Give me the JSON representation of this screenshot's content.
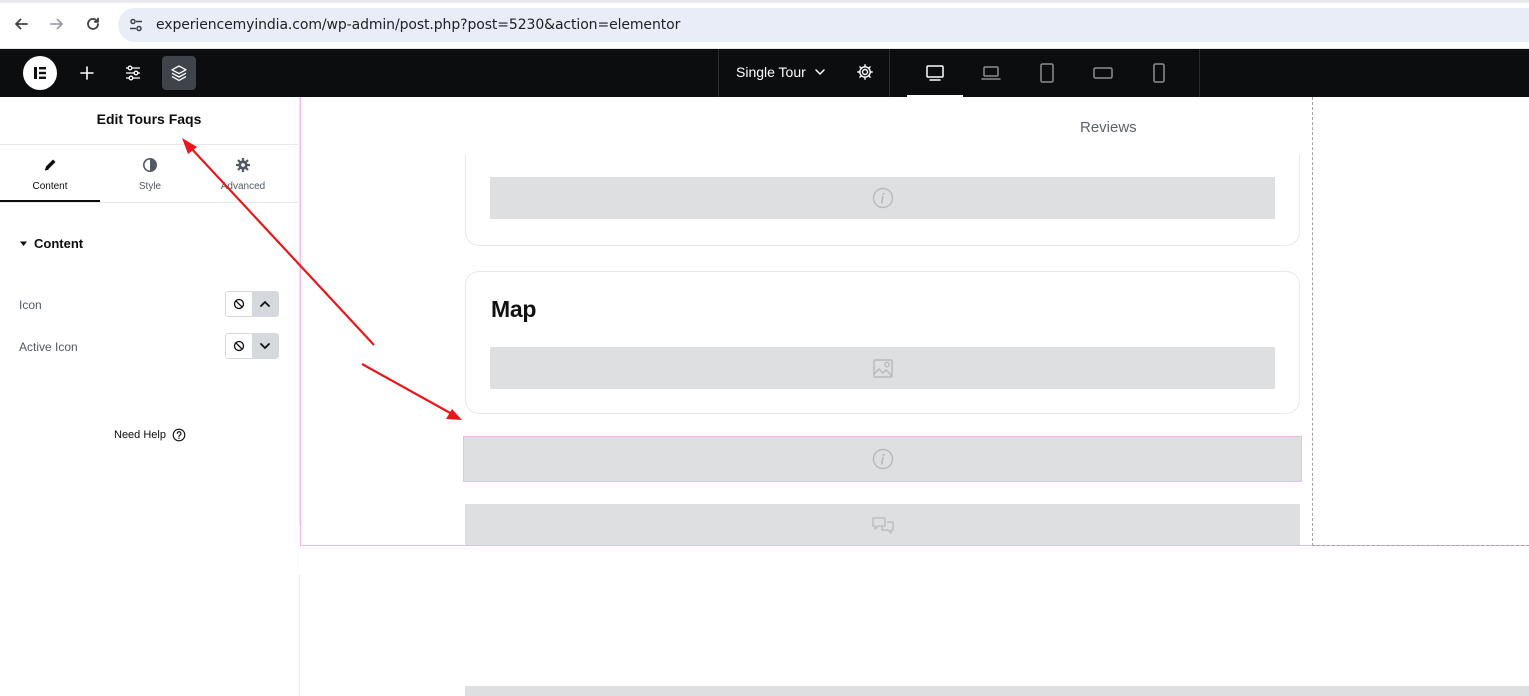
{
  "browser": {
    "url": "experiencemyindia.com/wp-admin/post.php?post=5230&action=elementor",
    "back_icon": "arrow-left-icon",
    "forward_icon": "arrow-right-icon",
    "reload_icon": "reload-icon",
    "site_info_icon": "tune-icon"
  },
  "topbar": {
    "template_name": "Single Tour",
    "devices": [
      "desktop",
      "laptop",
      "tablet",
      "tablet-landscape",
      "mobile"
    ],
    "active_device": "desktop"
  },
  "panel": {
    "title": "Edit Tours Faqs",
    "tabs": [
      {
        "label": "Content",
        "icon": "pencil-icon",
        "active": true
      },
      {
        "label": "Style",
        "icon": "half-circle-icon",
        "active": false
      },
      {
        "label": "Advanced",
        "icon": "gear-icon",
        "active": false
      }
    ],
    "section_title": "Content",
    "controls": [
      {
        "label": "Icon",
        "selected_icon": "chevron-up-icon"
      },
      {
        "label": "Active Icon",
        "selected_icon": "chevron-down-icon"
      }
    ],
    "need_help": "Need Help"
  },
  "canvas": {
    "reviews_label": "Reviews",
    "map_title": "Map"
  },
  "colors": {
    "topbar_bg": "#0c0d0e",
    "placeholder_bg": "#dddfe1",
    "selection_border": "#f0b8ec",
    "annotation_arrow": "#e8171b"
  }
}
